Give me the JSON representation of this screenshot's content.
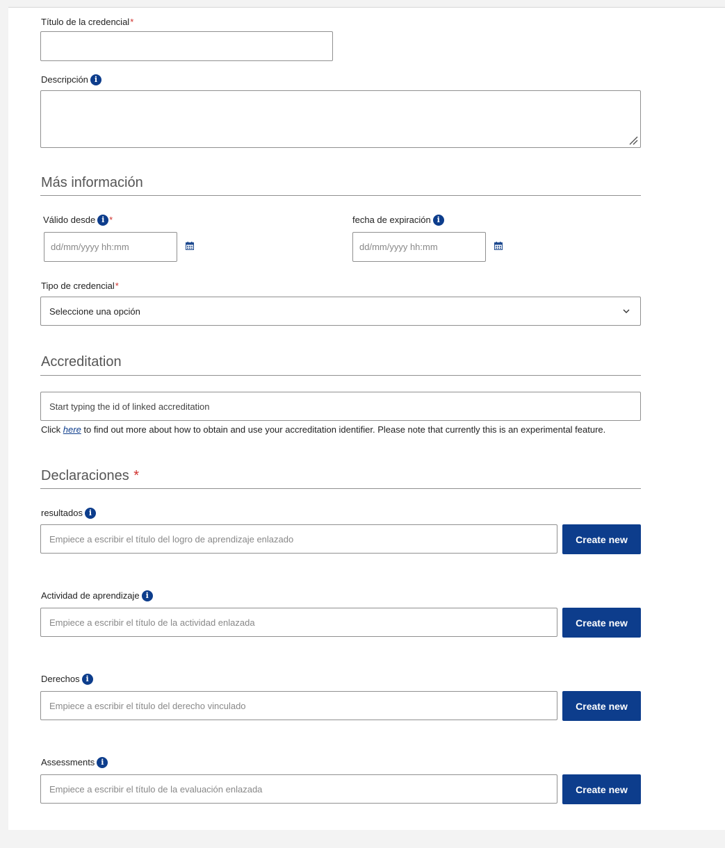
{
  "title_field": {
    "label": "Título de la credencial",
    "required_mark": "*",
    "value": ""
  },
  "description_field": {
    "label": "Descripción",
    "value": ""
  },
  "more_info": {
    "heading": "Más información",
    "valid_from": {
      "label": "Válido desde",
      "required_mark": "*",
      "placeholder": "dd/mm/yyyy hh:mm"
    },
    "expiration": {
      "label": "fecha de expiración",
      "placeholder": "dd/mm/yyyy hh:mm"
    },
    "credential_type": {
      "label": "Tipo de credencial",
      "required_mark": "*",
      "selected": "Seleccione una opción"
    }
  },
  "accreditation": {
    "heading": "Accreditation",
    "placeholder": "Start typing the id of linked accreditation",
    "help_prefix": "Click ",
    "help_link": "here",
    "help_suffix": " to find out more about how to obtain and use your accreditation identifier. Please note that currently this is an experimental feature."
  },
  "claims": {
    "heading": "Declaraciones",
    "required_mark": "*",
    "items": [
      {
        "label": "resultados",
        "placeholder": "Empiece a escribir el título del logro de aprendizaje enlazado",
        "button": "Create new"
      },
      {
        "label": "Actividad de aprendizaje",
        "placeholder": "Empiece a escribir el título de la actividad enlazada",
        "button": "Create new"
      },
      {
        "label": "Derechos",
        "placeholder": "Empiece a escribir el título del derecho vinculado",
        "button": "Create new"
      },
      {
        "label": "Assessments",
        "placeholder": "Empiece a escribir el título de la evaluación enlazada",
        "button": "Create new"
      }
    ]
  },
  "icons": {
    "info": "info-icon",
    "calendar": "calendar-icon",
    "chevron": "chevron-down-icon",
    "resize": "resize-handle-icon"
  },
  "colors": {
    "accent": "#0d3d8c",
    "required": "#d0312d",
    "border": "#8f8f8f"
  }
}
